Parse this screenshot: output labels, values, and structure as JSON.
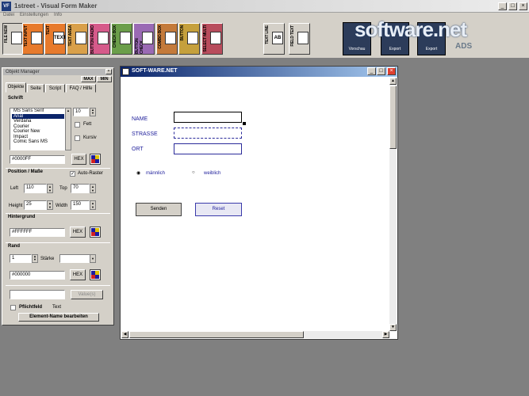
{
  "app": {
    "title": "1street - Visual Form Maker"
  },
  "menu": [
    "Datei",
    "Einstellungen",
    "Info"
  ],
  "toolbar": {
    "buttons": [
      {
        "label": "FILE NEW",
        "glyph": "",
        "color": "#d4d0c8"
      },
      {
        "label": "TEXT INPUT",
        "glyph": "",
        "color": "#e77a2c"
      },
      {
        "label": "TEXT",
        "glyph": "TEXT",
        "color": "#e77a2c"
      },
      {
        "label": "TEXT AREA",
        "glyph": "",
        "color": "#d9a04a"
      },
      {
        "label": "BUTTON RADIO",
        "glyph": "",
        "color": "#d65a8a"
      },
      {
        "label": "CHECK BOX",
        "glyph": "",
        "color": "#6b9e4a"
      },
      {
        "label": "BUTTON CHECK",
        "glyph": "",
        "color": "#9a6ab4"
      },
      {
        "label": "COMBO BOX",
        "glyph": "",
        "color": "#c47a3a"
      },
      {
        "label": "BUTTON",
        "glyph": "",
        "color": "#c5a03c"
      },
      {
        "label": "SELECT MULTI",
        "glyph": "",
        "color": "#b84c5c"
      },
      {
        "label": "TEXT LINE",
        "glyph": "AB",
        "color": "#d4d0c8"
      },
      {
        "label": "FIELD TEXT",
        "glyph": "",
        "color": "#d4d0c8"
      }
    ],
    "big_buttons": [
      "Vorschau",
      "Export",
      "Export"
    ]
  },
  "watermark": {
    "brand": "software.net",
    "suffix": "ADS"
  },
  "object_manager": {
    "title": "Objekt Manager",
    "max": "MAX",
    "min": "MIN",
    "tabs": [
      "Objekte",
      "Seite",
      "Script",
      "FAQ / Hilfe"
    ],
    "schrift_title": "Schrift",
    "fonts": [
      "MS Sans Serif",
      "Arial",
      "Verdana",
      "Courier",
      "Courier New",
      "Impact",
      "Comic Sans MS"
    ],
    "selected_font": "Arial",
    "font_size": "10",
    "fett": "Fett",
    "kursiv": "Kursiv",
    "font_color": "#0000FF",
    "hex": "HEX",
    "position_title": "Position / Maße",
    "auto_raster": "Auto-Raster",
    "left_label": "Left",
    "left_value": "110",
    "top_label": "Top",
    "top_value": "70",
    "height_label": "Height",
    "height_value": "25",
    "width_label": "Width",
    "width_value": "150",
    "hintergrund_title": "Hintergrund",
    "bg_color": "#FFFFFF",
    "rand_title": "Rand",
    "rand_value": "1",
    "staerke": "Stärke",
    "border_color": "#000000",
    "value_button": "Value(s)",
    "pflichtfeld": "Pflichtfeld",
    "text_label": "Text",
    "element_name_button": "Element-Name bearbeiten"
  },
  "form_window": {
    "title": "SOFT-WARE.NET",
    "labels": {
      "name": "NAME",
      "strasse": "STRASSE",
      "ort": "ORT"
    },
    "radio": {
      "male": "männlich",
      "female": "weiblich"
    },
    "buttons": {
      "submit": "Senden",
      "reset": "Reset"
    }
  }
}
